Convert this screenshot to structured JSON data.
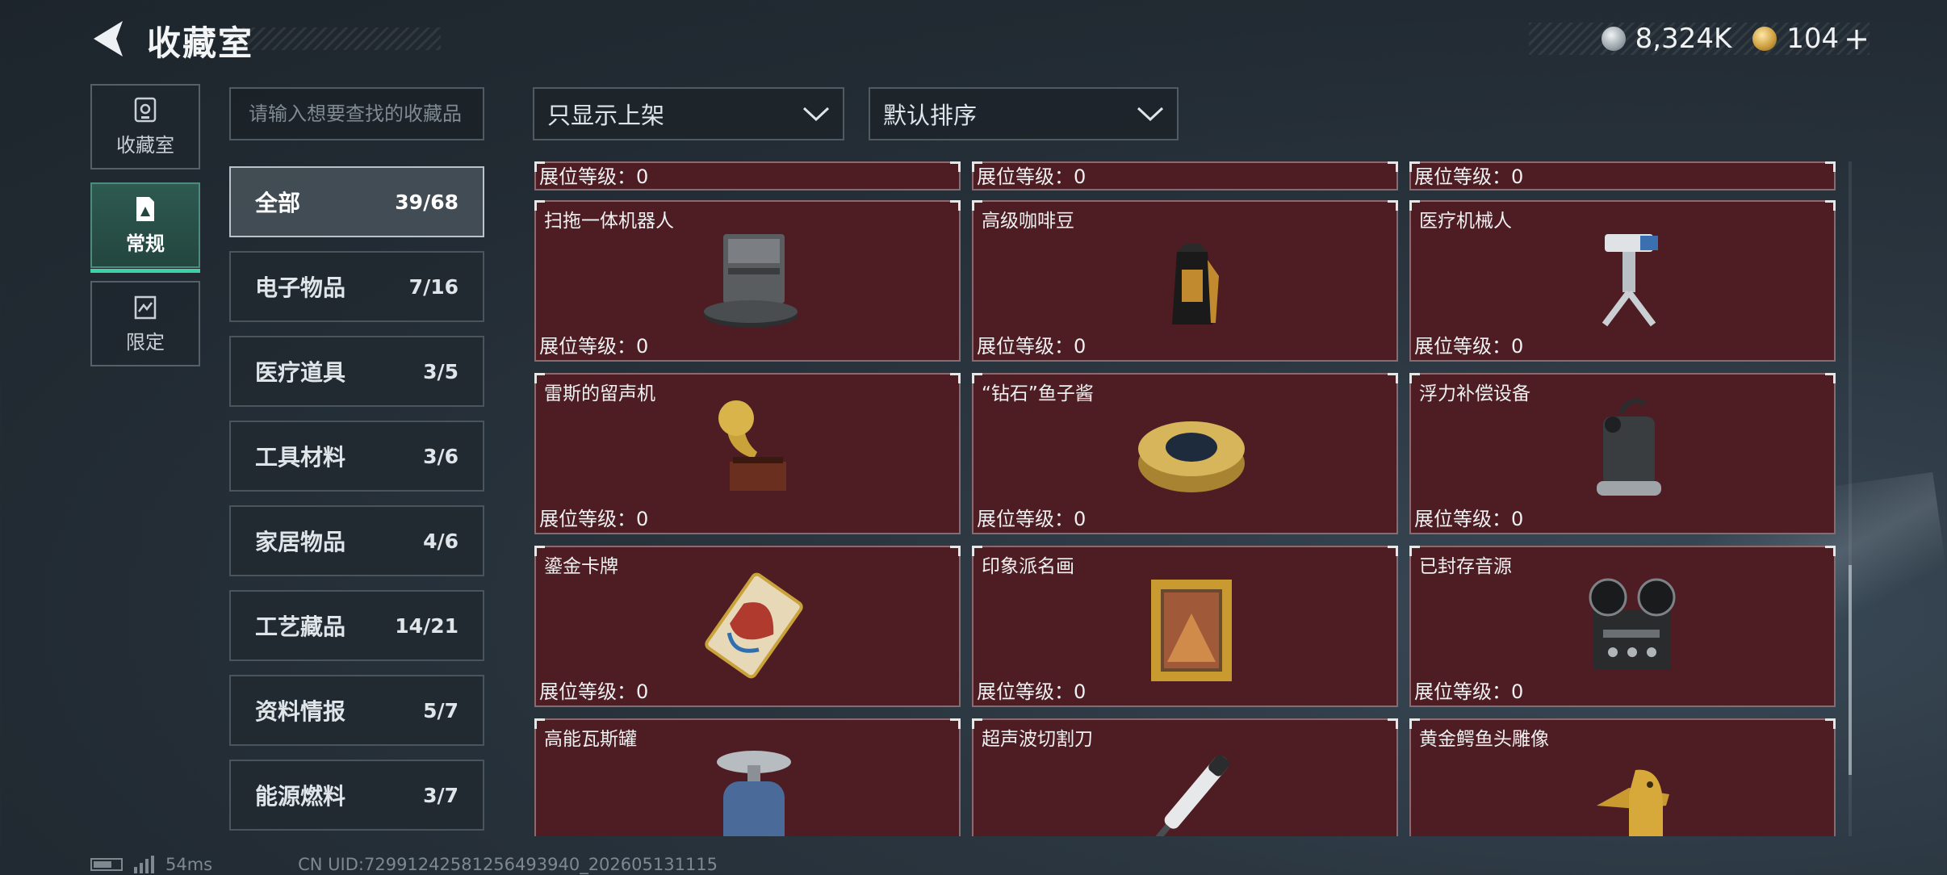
{
  "header": {
    "title": "收藏室",
    "currency_1": "8,324K",
    "currency_2": "104",
    "plus": "+"
  },
  "nav": [
    {
      "label": "收藏室",
      "icon": "trophy-icon"
    },
    {
      "label": "常规",
      "icon": "collection-icon"
    },
    {
      "label": "限定",
      "icon": "limited-icon"
    }
  ],
  "search": {
    "placeholder": "请输入想要查找的收藏品"
  },
  "categories": [
    {
      "name": "全部",
      "count": "39/68"
    },
    {
      "name": "电子物品",
      "count": "7/16"
    },
    {
      "name": "医疗道具",
      "count": "3/5"
    },
    {
      "name": "工具材料",
      "count": "3/6"
    },
    {
      "name": "家居物品",
      "count": "4/6"
    },
    {
      "name": "工艺藏品",
      "count": "14/21"
    },
    {
      "name": "资料情报",
      "count": "5/7"
    },
    {
      "name": "能源燃料",
      "count": "3/7"
    }
  ],
  "filters": {
    "filter_label": "只显示上架",
    "sort_label": "默认排序"
  },
  "level_label": "展位等级：0",
  "items": [
    {
      "name": "扫拖一体机器人",
      "icon": "robot-vacuum-icon"
    },
    {
      "name": "高级咖啡豆",
      "icon": "coffee-bag-icon"
    },
    {
      "name": "医疗机械人",
      "icon": "medical-robot-icon"
    },
    {
      "name": "雷斯的留声机",
      "icon": "gramophone-icon"
    },
    {
      "name": "“钻石”鱼子酱",
      "icon": "caviar-tin-icon"
    },
    {
      "name": "浮力补偿设备",
      "icon": "diving-gear-icon"
    },
    {
      "name": "鎏金卡牌",
      "icon": "gilded-card-icon"
    },
    {
      "name": "印象派名画",
      "icon": "framed-painting-icon"
    },
    {
      "name": "已封存音源",
      "icon": "reel-recorder-icon"
    },
    {
      "name": "高能瓦斯罐",
      "icon": "gas-canister-icon"
    },
    {
      "name": "超声波切割刀",
      "icon": "ultrasonic-cutter-icon"
    },
    {
      "name": "黄金鳄鱼头雕像",
      "icon": "gold-crocodile-statue-icon"
    }
  ],
  "footer": {
    "ping": "54ms",
    "uid": "CN UID:72991242581256493940_202605131115"
  },
  "colors": {
    "accent": "#3fd1a6",
    "card_bg": "#4e1d23"
  }
}
